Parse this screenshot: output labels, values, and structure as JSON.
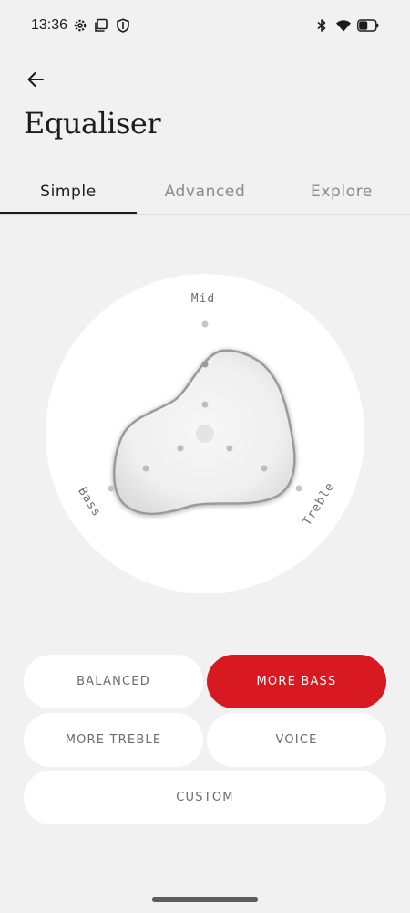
{
  "status_bar": {
    "time": "13:36",
    "left_icons": [
      "gear-icon",
      "screenshot-icon",
      "shield-icon"
    ],
    "right_icons": [
      "bluetooth-icon",
      "wifi-icon",
      "battery-icon"
    ]
  },
  "header": {
    "title": "Equaliser"
  },
  "tabs": [
    {
      "label": "Simple",
      "active": true
    },
    {
      "label": "Advanced",
      "active": false
    },
    {
      "label": "Explore",
      "active": false
    }
  ],
  "eq_dial": {
    "labels": {
      "mid": "Mid",
      "bass": "Bass",
      "treble": "Treble"
    }
  },
  "presets": {
    "balanced": "BALANCED",
    "more_bass": "MORE BASS",
    "more_treble": "MORE TREBLE",
    "voice": "VOICE",
    "custom": "CUSTOM",
    "selected": "MORE BASS"
  },
  "colors": {
    "accent": "#d81921",
    "background": "#f1f1f1",
    "card": "#ffffff"
  }
}
